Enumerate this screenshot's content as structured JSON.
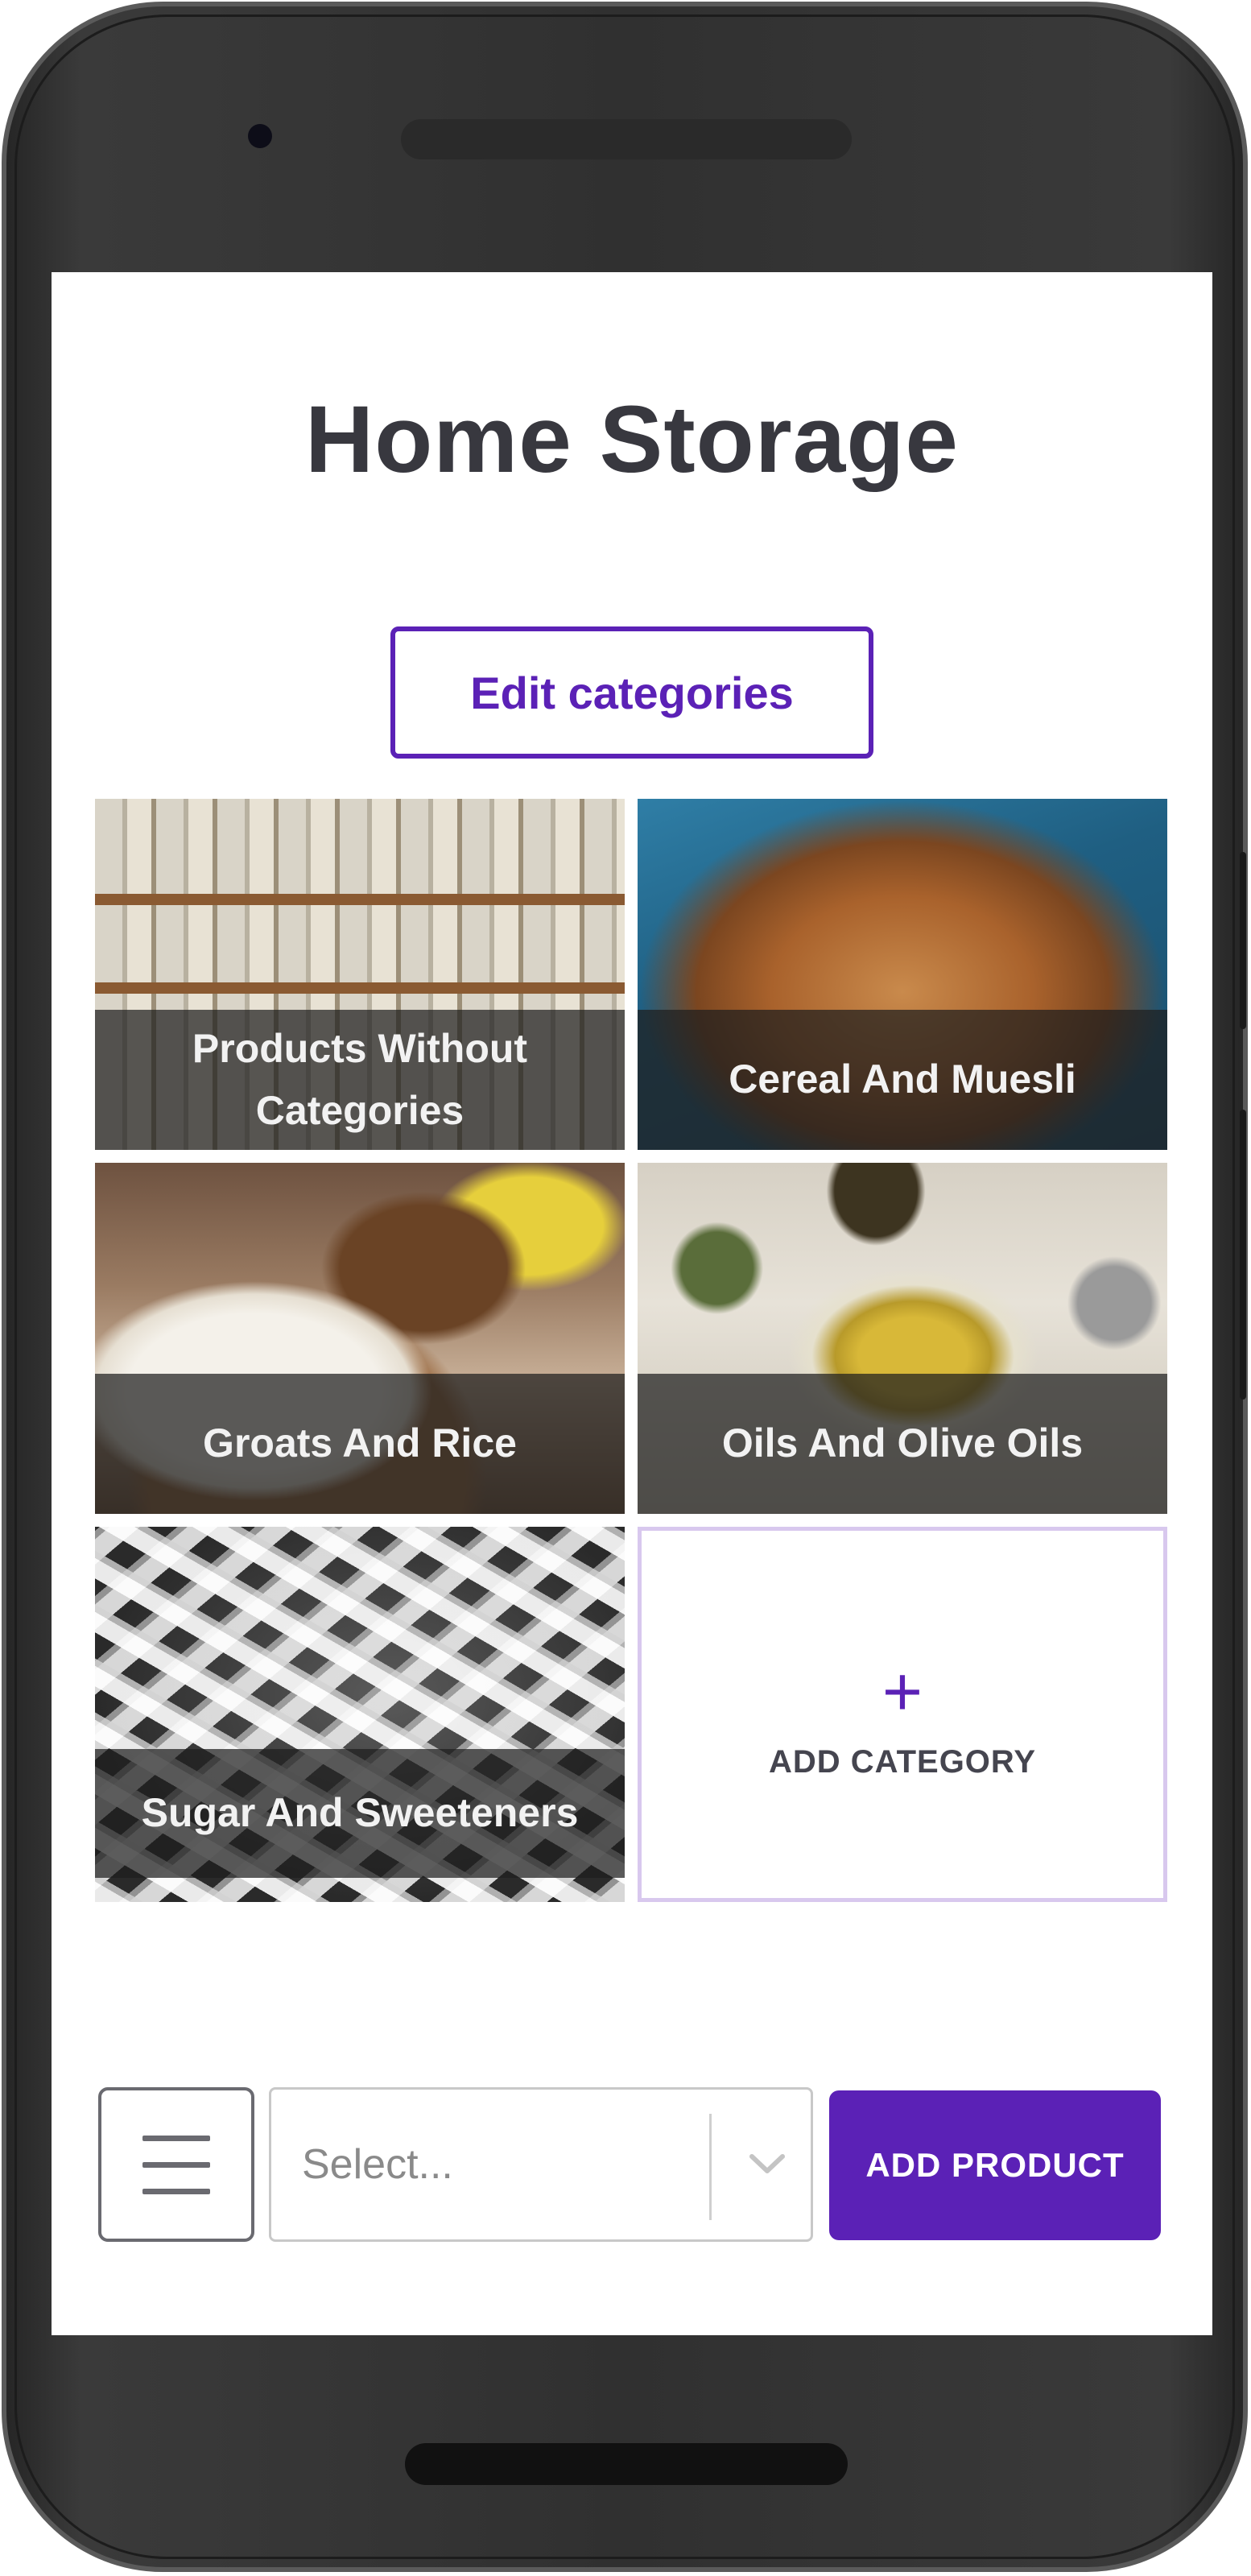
{
  "app": {
    "title": "Home Storage"
  },
  "toolbar": {
    "edit_categories_label": "Edit categories"
  },
  "categories": [
    {
      "label": "Products Without Categories",
      "image": "pantry-shelves"
    },
    {
      "label": "Cereal And Muesli",
      "image": "muesli-bowl"
    },
    {
      "label": "Groats And Rice",
      "image": "rice-and-groats"
    },
    {
      "label": "Oils And Olive Oils",
      "image": "olive-oil"
    },
    {
      "label": "Sugar And Sweeteners",
      "image": "sugar-cubes"
    }
  ],
  "add_category": {
    "icon": "plus-icon",
    "label": "ADD CATEGORY"
  },
  "bottom_bar": {
    "menu_icon": "hamburger-menu-icon",
    "select": {
      "placeholder": "Select...",
      "icon": "chevron-down-icon"
    },
    "add_product_label": "ADD PRODUCT"
  },
  "colors": {
    "accent": "#5b21b6",
    "title": "#38383f"
  }
}
